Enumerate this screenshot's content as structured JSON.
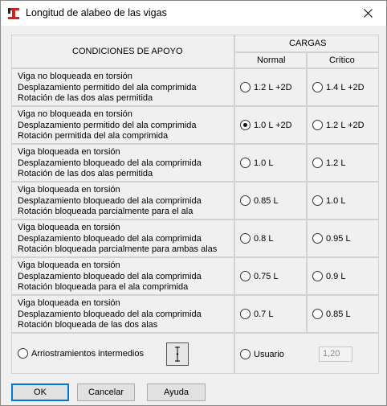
{
  "window": {
    "title": "Longitud de alabeo de las vigas",
    "close_glyph": "✕",
    "icon": "app-logo-icon"
  },
  "header": {
    "condiciones": "CONDICIONES DE APOYO",
    "cargas": "CARGAS",
    "normal": "Normal",
    "critico": "Crítico"
  },
  "rows": [
    {
      "lines": [
        "Viga no bloqueada en torsión",
        "Desplazamiento permitido del ala comprimida",
        "Rotación de las dos alas permitida"
      ],
      "normal": "1.2 L +2D",
      "critico": "1.4 L +2D",
      "normal_checked": false,
      "critico_checked": false
    },
    {
      "lines": [
        "Viga no bloqueada en torsión",
        "Desplazamiento permitido del ala comprimida",
        "Rotación permitida del ala comprimida"
      ],
      "normal": "1.0 L +2D",
      "critico": "1.2 L +2D",
      "normal_checked": true,
      "critico_checked": false
    },
    {
      "lines": [
        "Viga bloqueada en torsión",
        "Desplazamiento bloqueado del ala comprimida",
        "Rotación de las dos alas permitida"
      ],
      "normal": "1.0 L",
      "critico": "1.2 L",
      "normal_checked": false,
      "critico_checked": false
    },
    {
      "lines": [
        "Viga bloqueada en torsión",
        "Desplazamiento bloqueado del ala comprimida",
        "Rotación bloqueada parcialmente para el ala"
      ],
      "normal": "0.85 L",
      "critico": "1.0 L",
      "normal_checked": false,
      "critico_checked": false
    },
    {
      "lines": [
        "Viga bloqueada en torsión",
        "Desplazamiento bloqueado del ala comprimida",
        "Rotación bloqueada parcialmente para ambas alas"
      ],
      "normal": "0.8 L",
      "critico": "0.95 L",
      "normal_checked": false,
      "critico_checked": false
    },
    {
      "lines": [
        "Viga bloqueada en torsión",
        "Desplazamiento bloqueado del ala comprimida",
        "Rotación bloqueada para el ala comprimida"
      ],
      "normal": "0.75 L",
      "critico": "0.9 L",
      "normal_checked": false,
      "critico_checked": false
    },
    {
      "lines": [
        "Viga bloqueada en torsión",
        "Desplazamiento bloqueado del ala comprimida",
        "Rotación bloqueada de las dos alas"
      ],
      "normal": "0.7 L",
      "critico": "0.85 L",
      "normal_checked": false,
      "critico_checked": false
    }
  ],
  "footer_row": {
    "arriostramientos": "Arriostramientos intermedios",
    "arriostramientos_checked": false,
    "usuario": "Usuario",
    "usuario_checked": false,
    "usuario_value": "1,20",
    "diagram_icon": "bracing-diagram-icon"
  },
  "buttons": {
    "ok": "OK",
    "cancel": "Cancelar",
    "help": "Ayuda"
  },
  "colors": {
    "focus_border": "#0078d7",
    "icon_red": "#d42020"
  }
}
